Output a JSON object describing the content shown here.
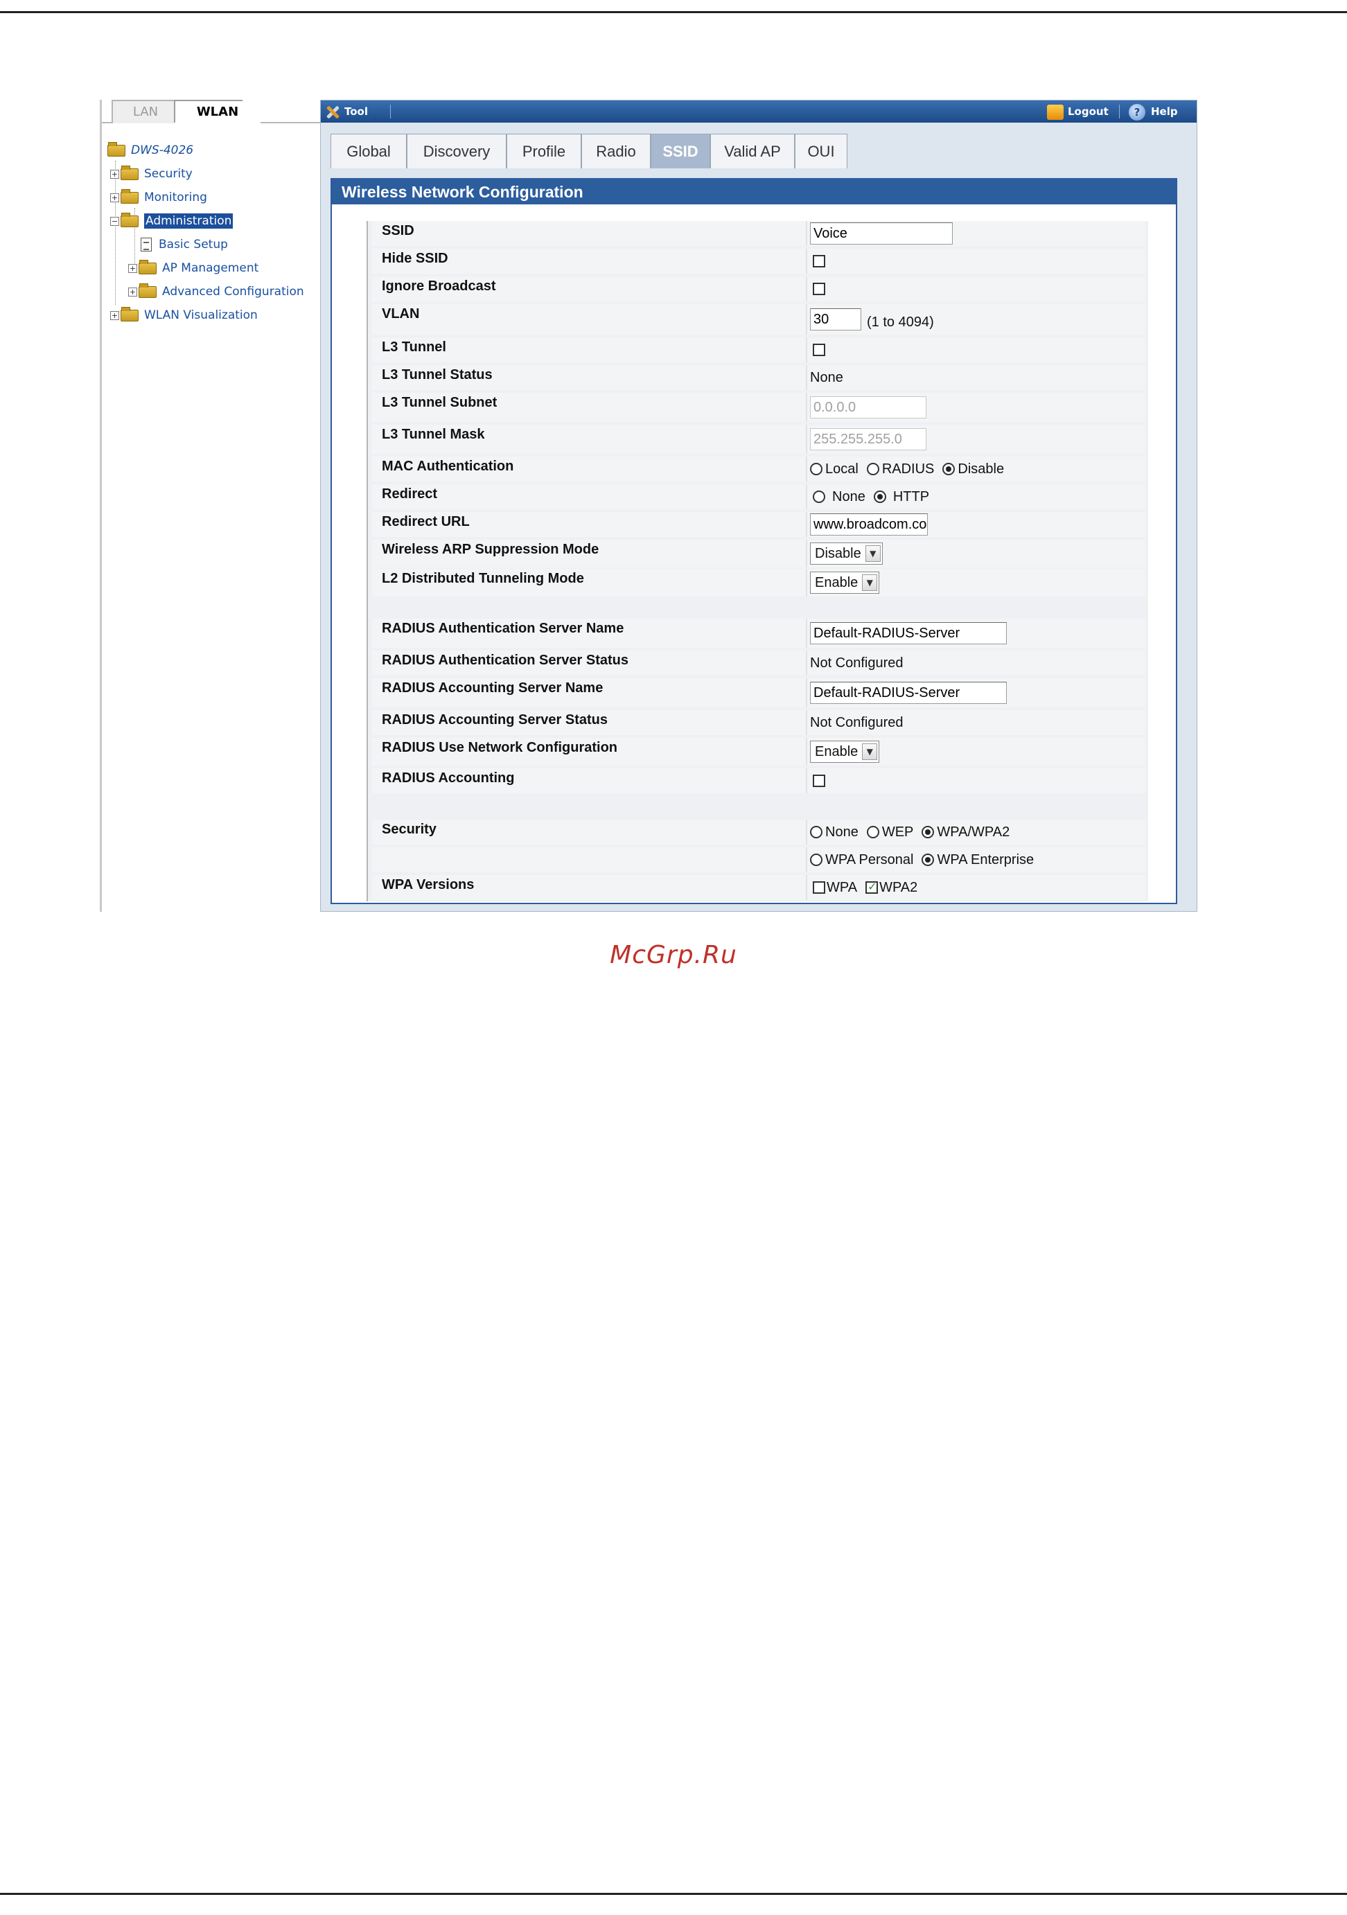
{
  "nav": {
    "tabs": [
      {
        "label": "LAN",
        "active": false
      },
      {
        "label": "WLAN",
        "active": true
      }
    ],
    "tree": {
      "root": "DWS-4026",
      "security": "Security",
      "monitoring": "Monitoring",
      "administration": "Administration",
      "basic_setup": "Basic Setup",
      "ap_management": "AP Management",
      "advanced_configuration": "Advanced Configuration",
      "wlan_visualization": "WLAN Visualization",
      "expand_plus": "+",
      "expand_minus": "−"
    }
  },
  "toolbar": {
    "tool": "Tool",
    "logout": "Logout",
    "help": "Help",
    "help_glyph": "?"
  },
  "tabs": [
    "Global",
    "Discovery",
    "Profile",
    "Radio",
    "SSID",
    "Valid AP",
    "OUI"
  ],
  "active_tab": "SSID",
  "panel_title": "Wireless Network Configuration",
  "fields": {
    "ssid": {
      "label": "SSID",
      "value": "Voice"
    },
    "hide_ssid": {
      "label": "Hide SSID",
      "checked": false
    },
    "ignore_broadcast": {
      "label": "Ignore Broadcast",
      "checked": false
    },
    "vlan": {
      "label": "VLAN",
      "value": "30",
      "hint": "(1 to 4094)"
    },
    "l3_tunnel": {
      "label": "L3 Tunnel",
      "checked": false
    },
    "l3_tunnel_status": {
      "label": "L3 Tunnel Status",
      "value": "None"
    },
    "l3_tunnel_subnet": {
      "label": "L3 Tunnel Subnet",
      "value": "0.0.0.0"
    },
    "l3_tunnel_mask": {
      "label": "L3 Tunnel Mask",
      "value": "255.255.255.0"
    },
    "mac_auth": {
      "label": "MAC Authentication",
      "options": [
        "Local",
        "RADIUS",
        "Disable"
      ],
      "selected": "Disable"
    },
    "redirect": {
      "label": "Redirect",
      "options": [
        "None",
        "HTTP"
      ],
      "selected": "HTTP"
    },
    "redirect_url": {
      "label": "Redirect URL",
      "value": "www.broadcom.co"
    },
    "arp_suppression": {
      "label": "Wireless ARP Suppression Mode",
      "value": "Disable"
    },
    "l2_tunneling": {
      "label": "L2 Distributed Tunneling Mode",
      "value": "Enable"
    },
    "radius_auth_name": {
      "label": "RADIUS Authentication Server Name",
      "value": "Default-RADIUS-Server"
    },
    "radius_auth_status": {
      "label": "RADIUS Authentication Server Status",
      "value": "Not Configured"
    },
    "radius_acct_name": {
      "label": "RADIUS Accounting Server Name",
      "value": "Default-RADIUS-Server"
    },
    "radius_acct_status": {
      "label": "RADIUS Accounting Server Status",
      "value": "Not Configured"
    },
    "radius_network_cfg": {
      "label": "RADIUS Use Network Configuration",
      "value": "Enable"
    },
    "radius_accounting": {
      "label": "RADIUS Accounting",
      "checked": false
    },
    "security": {
      "label": "Security",
      "options": [
        "None",
        "WEP",
        "WPA/WPA2"
      ],
      "selected": "WPA/WPA2"
    },
    "wpa_mode": {
      "options": [
        "WPA Personal",
        "WPA Enterprise"
      ],
      "selected": "WPA Enterprise"
    },
    "wpa_versions": {
      "label": "WPA Versions",
      "options": [
        "WPA",
        "WPA2"
      ],
      "checked": [
        "WPA2"
      ]
    }
  },
  "select_arrow_glyph": "▼",
  "watermark": "McGrp.Ru"
}
